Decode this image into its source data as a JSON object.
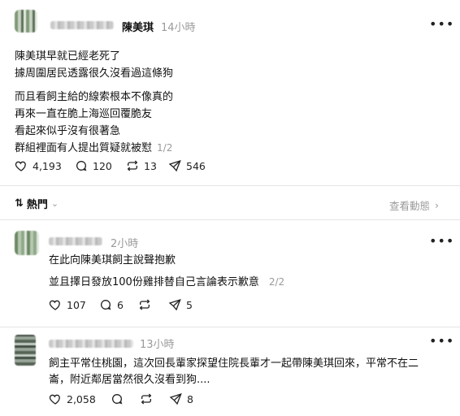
{
  "post": {
    "author_name": "陳美琪",
    "time": "14小時",
    "more_icon": "more-dots-icon",
    "lines": [
      "陳美琪早就已經老死了",
      "據周圍居民透露很久沒看過這條狗",
      "而且看飼主給的線索根本不像真的",
      "再來一直在脆上海巡回覆脆友",
      "看起來似乎沒有很著急",
      "群組裡面有人提出質疑就被懟"
    ],
    "pager": "1/2",
    "stats": {
      "likes": "4,193",
      "comments": "120",
      "reposts": "13",
      "shares": "546"
    }
  },
  "sort": {
    "label": "熱門",
    "view_activity": "查看動態"
  },
  "reply1": {
    "time": "2小時",
    "lines": [
      "在此向陳美琪飼主說聲抱歉",
      "並且擇日發放100份雞排替自己言論表示歉意"
    ],
    "pager": "2/2",
    "stats": {
      "likes": "107",
      "comments": "6",
      "shares": "5"
    }
  },
  "reply2": {
    "time": "13小時",
    "lines": [
      "飼主平常住桃園，這次回長輩家探望住院長輩才一起帶陳美琪回來，平常不在二",
      "崙，附近鄰居當然很久沒看到狗...."
    ],
    "stats": {
      "likes": "2,058",
      "shares": "8"
    }
  }
}
